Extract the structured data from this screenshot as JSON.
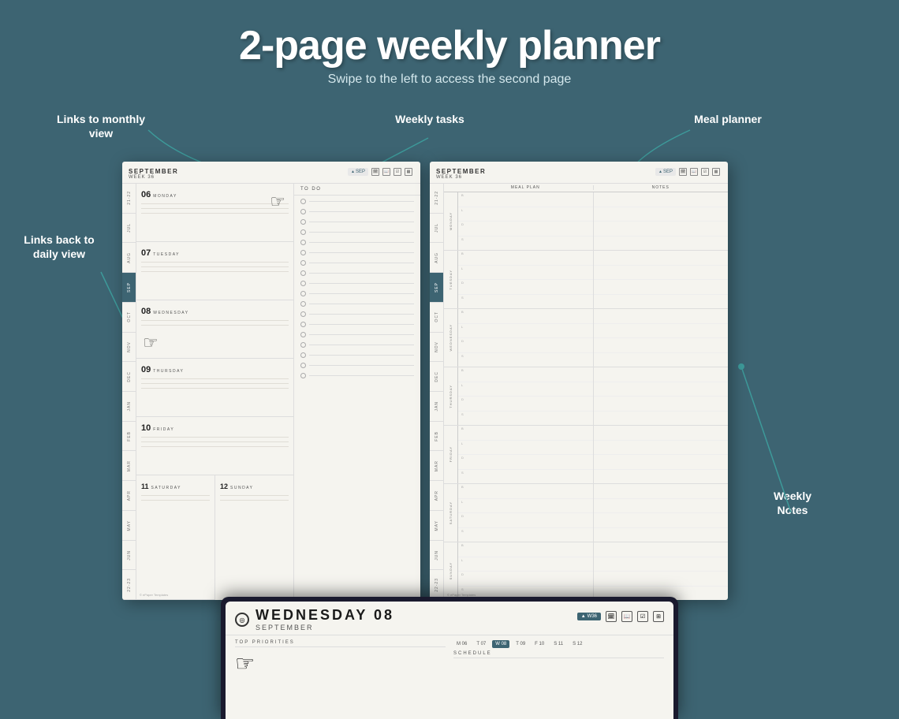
{
  "page": {
    "title": "2-page weekly planner",
    "subtitle": "Swipe to the left to access the second page",
    "bg_color": "#3d6472"
  },
  "annotations": {
    "monthly": "Links to monthly view",
    "tasks": "Weekly tasks",
    "meal": "Meal planner",
    "daily": "Links back to daily view",
    "notes": "Weekly Notes"
  },
  "page1": {
    "month": "SEPTEMBER",
    "week": "WEEK 36",
    "nav_btn": "▲ SEP",
    "section_todo": "TO DO",
    "days": [
      {
        "num": "06",
        "name": "MONDAY"
      },
      {
        "num": "07",
        "name": "TUESDAY"
      },
      {
        "num": "08",
        "name": "WEDNESDAY"
      },
      {
        "num": "09",
        "name": "THURSDAY"
      },
      {
        "num": "10",
        "name": "FRIDAY"
      }
    ],
    "weekend": [
      {
        "num": "11",
        "name": "SATURDAY"
      },
      {
        "num": "12",
        "name": "SUNDAY"
      }
    ],
    "months_sidebar": [
      "21-22",
      "JUL",
      "AUG",
      "SEP",
      "OCT",
      "NOV",
      "DEC",
      "JAN",
      "FEB",
      "MAR",
      "APR",
      "MAY",
      "JUN",
      "22-23"
    ]
  },
  "page2": {
    "month": "SEPTEMBER",
    "week": "WEEK 36",
    "nav_btn": "▲ SEP",
    "col_meal": "MEAL PLAN",
    "col_notes": "NOTES",
    "days": [
      {
        "name": "MONDAY",
        "meals": [
          "B",
          "L",
          "D",
          "S"
        ]
      },
      {
        "name": "TUESDAY",
        "meals": [
          "B",
          "L",
          "D",
          "S"
        ]
      },
      {
        "name": "WEDNESDAY",
        "meals": [
          "B",
          "L",
          "D",
          "S"
        ]
      },
      {
        "name": "THURSDAY",
        "meals": [
          "B",
          "L",
          "D",
          "S"
        ]
      },
      {
        "name": "FRIDAY",
        "meals": [
          "B",
          "L",
          "D",
          "S"
        ]
      },
      {
        "name": "SATURDAY",
        "meals": [
          "B",
          "L",
          "D",
          "S"
        ]
      },
      {
        "name": "SUNDAY",
        "meals": [
          "B",
          "L",
          "D",
          "S"
        ]
      }
    ]
  },
  "device": {
    "day": "WEDNESDAY 08",
    "month": "SEPTEMBER",
    "week_badge": "W36",
    "priorities_label": "TOP PRIORITIES",
    "schedule_label": "SCHEDULE",
    "week_days": [
      "M 06",
      "T 07",
      "W 08",
      "T 09",
      "F 10",
      "S 11",
      "S 12"
    ],
    "active_day": "W 08"
  },
  "credit": "© ePaper Templates"
}
